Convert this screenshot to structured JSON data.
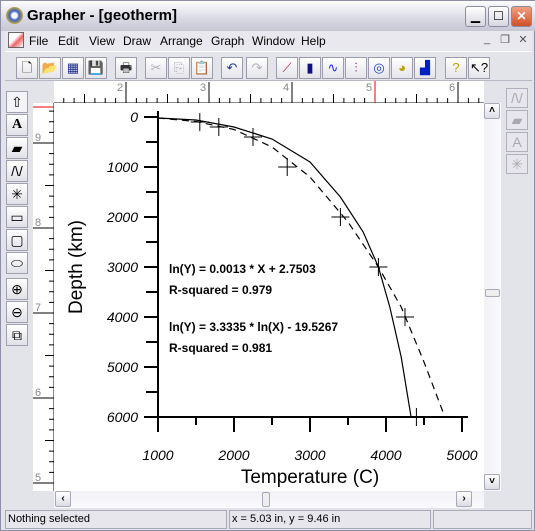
{
  "window": {
    "title": "Grapher - [geotherm]",
    "controls": [
      "minimize",
      "maximize",
      "close"
    ]
  },
  "menubar": {
    "items": [
      "File",
      "Edit",
      "View",
      "Draw",
      "Arrange",
      "Graph",
      "Window",
      "Help"
    ]
  },
  "toolbar": {
    "buttons": [
      {
        "icon": "new-file-icon",
        "glyph": "🗋",
        "enabled": true
      },
      {
        "icon": "open-folder-icon",
        "glyph": "📂",
        "enabled": true
      },
      {
        "icon": "worksheet-icon",
        "glyph": "▦",
        "enabled": true
      },
      {
        "icon": "save-icon",
        "glyph": "💾",
        "enabled": true
      },
      {
        "icon": "print-icon",
        "glyph": "🖶",
        "enabled": true
      },
      {
        "icon": "cut-icon",
        "glyph": "✂",
        "enabled": false
      },
      {
        "icon": "copy-icon",
        "glyph": "⎘",
        "enabled": false
      },
      {
        "icon": "paste-icon",
        "glyph": "📋",
        "enabled": true
      },
      {
        "icon": "undo-icon",
        "glyph": "↶",
        "enabled": true
      },
      {
        "icon": "redo-icon",
        "glyph": "↷",
        "enabled": false
      },
      {
        "icon": "line-graph-icon",
        "glyph": "⟋",
        "enabled": true
      },
      {
        "icon": "bar-chart-icon",
        "glyph": "▮",
        "enabled": true
      },
      {
        "icon": "function-plot-icon",
        "glyph": "∿",
        "enabled": true
      },
      {
        "icon": "hilo-plot-icon",
        "glyph": "⫶",
        "enabled": true
      },
      {
        "icon": "polar-plot-icon",
        "glyph": "◎",
        "enabled": true
      },
      {
        "icon": "pie-chart-icon",
        "glyph": "◕",
        "enabled": true
      },
      {
        "icon": "histogram-icon",
        "glyph": "▟",
        "enabled": true
      },
      {
        "icon": "help-icon",
        "glyph": "?",
        "enabled": true
      },
      {
        "icon": "context-help-icon",
        "glyph": "↖?",
        "enabled": true
      }
    ]
  },
  "left_tools": [
    {
      "icon": "select-arrow-icon",
      "glyph": "⇧"
    },
    {
      "icon": "text-tool-icon",
      "glyph": "A"
    },
    {
      "icon": "polygon-tool-icon",
      "glyph": "▰"
    },
    {
      "icon": "polyline-tool-icon",
      "glyph": "/\\/"
    },
    {
      "icon": "symbol-tool-icon",
      "glyph": "✳"
    },
    {
      "icon": "rectangle-tool-icon",
      "glyph": "▭"
    },
    {
      "icon": "rounded-rectangle-tool-icon",
      "glyph": "▢"
    },
    {
      "icon": "ellipse-tool-icon",
      "glyph": "⬭"
    },
    {
      "icon": "zoom-in-icon",
      "glyph": "⊕"
    },
    {
      "icon": "zoom-out-icon",
      "glyph": "⊖"
    },
    {
      "icon": "zoom-page-icon",
      "glyph": "⧉"
    }
  ],
  "right_tools": [
    {
      "icon": "line-properties-icon",
      "glyph": "/\\/"
    },
    {
      "icon": "fill-properties-icon",
      "glyph": "▰"
    },
    {
      "icon": "text-properties-icon",
      "glyph": "A"
    },
    {
      "icon": "symbol-properties-icon",
      "glyph": "✳"
    }
  ],
  "rulers": {
    "top_labels": [
      "2",
      "3",
      "4",
      "5",
      "6"
    ],
    "left_labels": [
      "9",
      "8",
      "7",
      "6",
      "5"
    ],
    "units": "in"
  },
  "status": {
    "selection": "Nothing selected",
    "cursor": "x = 5.03 in, y = 9.46 in",
    "extra": ""
  },
  "chart_data": {
    "type": "line",
    "xlabel": "Temperature (C)",
    "ylabel": "Depth (km)",
    "xlim": [
      1000,
      5000
    ],
    "ylim": [
      0,
      6000
    ],
    "y_inverted": true,
    "x_ticks": [
      "1000",
      "2000",
      "3000",
      "4000",
      "5000"
    ],
    "y_ticks": [
      "0",
      "1000",
      "2000",
      "3000",
      "4000",
      "5000",
      "6000"
    ],
    "grid": false,
    "series": [
      {
        "kind": "scatter",
        "marker": "cross",
        "points": [
          [
            1550,
            100
          ],
          [
            1800,
            200
          ],
          [
            2250,
            400
          ],
          [
            2700,
            1000
          ],
          [
            3400,
            2000
          ],
          [
            3900,
            3000
          ],
          [
            4250,
            4000
          ],
          [
            4400,
            6000
          ]
        ]
      },
      {
        "kind": "fit-exponential",
        "style": "solid",
        "points": [
          [
            1000,
            20
          ],
          [
            1500,
            60
          ],
          [
            2000,
            200
          ],
          [
            2500,
            440
          ],
          [
            3000,
            900
          ],
          [
            3400,
            1600
          ],
          [
            3700,
            2300
          ],
          [
            3900,
            3000
          ],
          [
            4050,
            3800
          ],
          [
            4200,
            4800
          ],
          [
            4330,
            6000
          ]
        ]
      },
      {
        "kind": "fit-power",
        "style": "dashed",
        "points": [
          [
            1000,
            20
          ],
          [
            1500,
            90
          ],
          [
            2000,
            250
          ],
          [
            2500,
            600
          ],
          [
            3000,
            1200
          ],
          [
            3500,
            2100
          ],
          [
            3900,
            3000
          ],
          [
            4200,
            3800
          ],
          [
            4500,
            4900
          ],
          [
            4750,
            5900
          ]
        ]
      }
    ],
    "annotations": [
      "ln(Y) = 0.0013 * X + 2.7503",
      "R-squared = 0.979",
      "ln(Y) = 3.3335 * ln(X) - 19.5267",
      "R-squared = 0.981"
    ]
  }
}
